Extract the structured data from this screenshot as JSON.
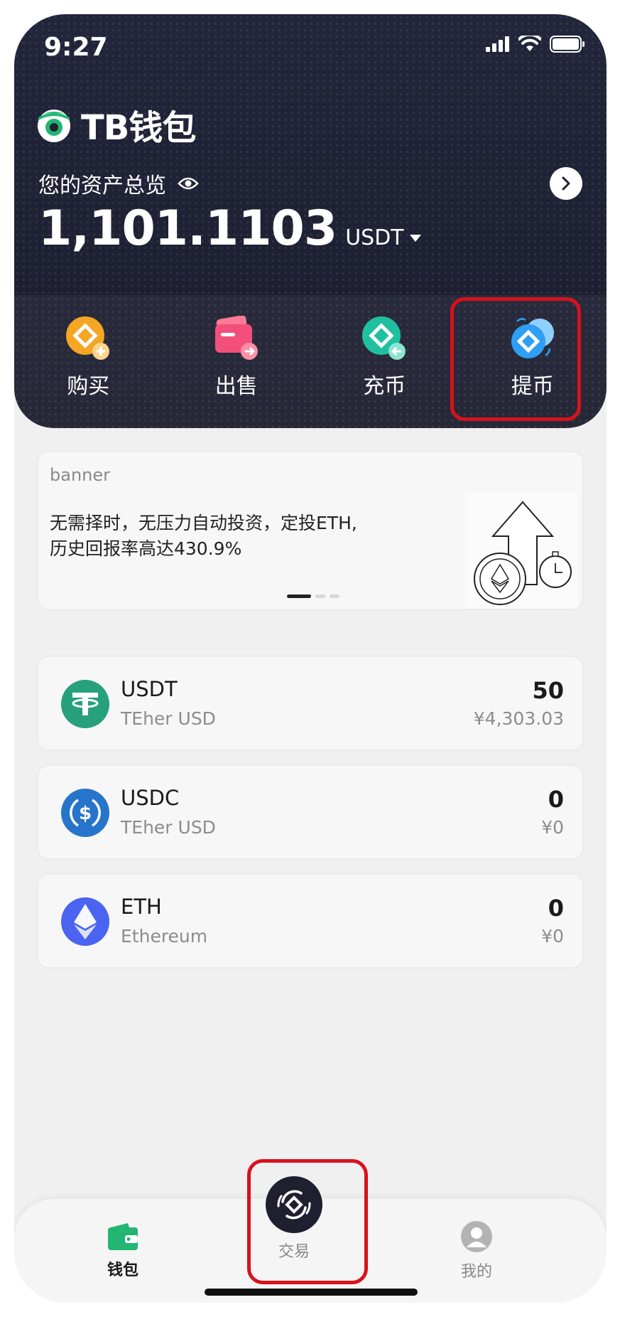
{
  "status_bar": {
    "time": "9:27"
  },
  "brand": {
    "name": "TB钱包"
  },
  "overview": {
    "label": "您的资产总览",
    "balance": "1,101.1103",
    "unit": "USDT"
  },
  "actions": [
    {
      "label": "购买",
      "icon": "buy-icon"
    },
    {
      "label": "出售",
      "icon": "sell-icon"
    },
    {
      "label": "充币",
      "icon": "deposit-icon"
    },
    {
      "label": "提币",
      "icon": "withdraw-icon"
    }
  ],
  "banner": {
    "tag": "banner",
    "line1": "无需择时，无压力自动投资，定投ETH,",
    "line2": "历史回报率高达430.9%"
  },
  "coins": [
    {
      "symbol": "USDT",
      "name": "TEher USD",
      "amount": "50",
      "fiat": "¥4,303.03",
      "color": "#26a17b",
      "icon": "tether-icon"
    },
    {
      "symbol": "USDC",
      "name": "TEher USD",
      "amount": "0",
      "fiat": "¥0",
      "color": "#2775ca",
      "icon": "usdc-icon"
    },
    {
      "symbol": "ETH",
      "name": "Ethereum",
      "amount": "0",
      "fiat": "¥0",
      "color": "#4a63f0",
      "icon": "ethereum-icon"
    }
  ],
  "tabbar": {
    "wallet": "钱包",
    "trade": "交易",
    "me": "我的"
  },
  "colors": {
    "header_bg": "#1e2030",
    "highlight": "#d9111b",
    "brand_green": "#22b573"
  }
}
